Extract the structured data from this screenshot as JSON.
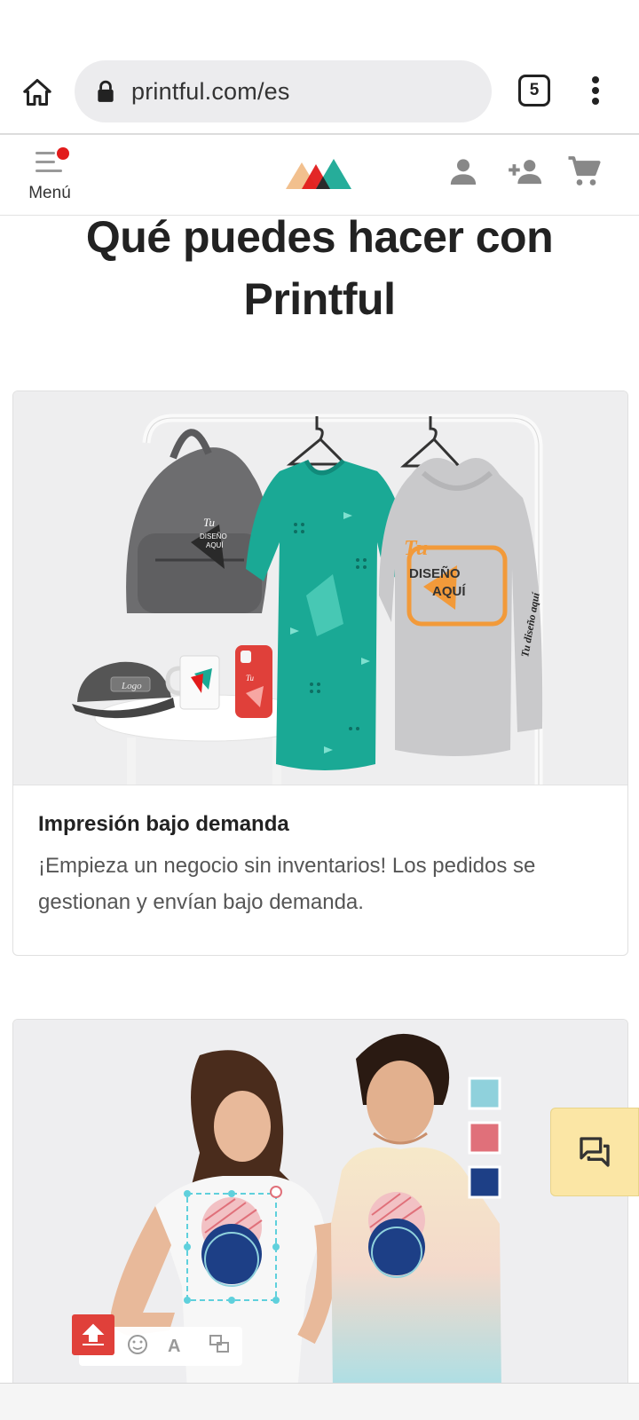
{
  "browser": {
    "url": "printful.com/es",
    "tab_count": "5",
    "icons": [
      "home-icon",
      "lock-icon",
      "tabs-icon",
      "more-vert-icon"
    ]
  },
  "header": {
    "menu_label": "Menú",
    "icons": [
      "hamburger-icon",
      "printful-logo",
      "account-icon",
      "register-icon",
      "cart-icon"
    ],
    "notification_dot_color": "#e21b1b"
  },
  "main": {
    "title": "Qué puedes hacer con Printful",
    "cards": [
      {
        "title": "Impresión bajo demanda",
        "text": "¡Empieza un negocio sin inventarios! Los pedidos se gestionan y envían bajo demanda."
      }
    ],
    "product_prints": {
      "backpack": "Tu\nDISEÑO\nAQUÍ",
      "cap": "Logo",
      "hoodie": "Tu\nDISEÑO\nAQUÍ",
      "sleeve": "Tu diseño aquí"
    },
    "swatch_colors": [
      "#8fd1dc",
      "#e0707a",
      "#1d3f86"
    ]
  },
  "chat": {
    "icon": "chat-icon",
    "background": "#fbe6a5"
  },
  "colors": {
    "brand_red": "#e21b1b",
    "teal": "#1aa995",
    "sand": "#f2c08e"
  }
}
